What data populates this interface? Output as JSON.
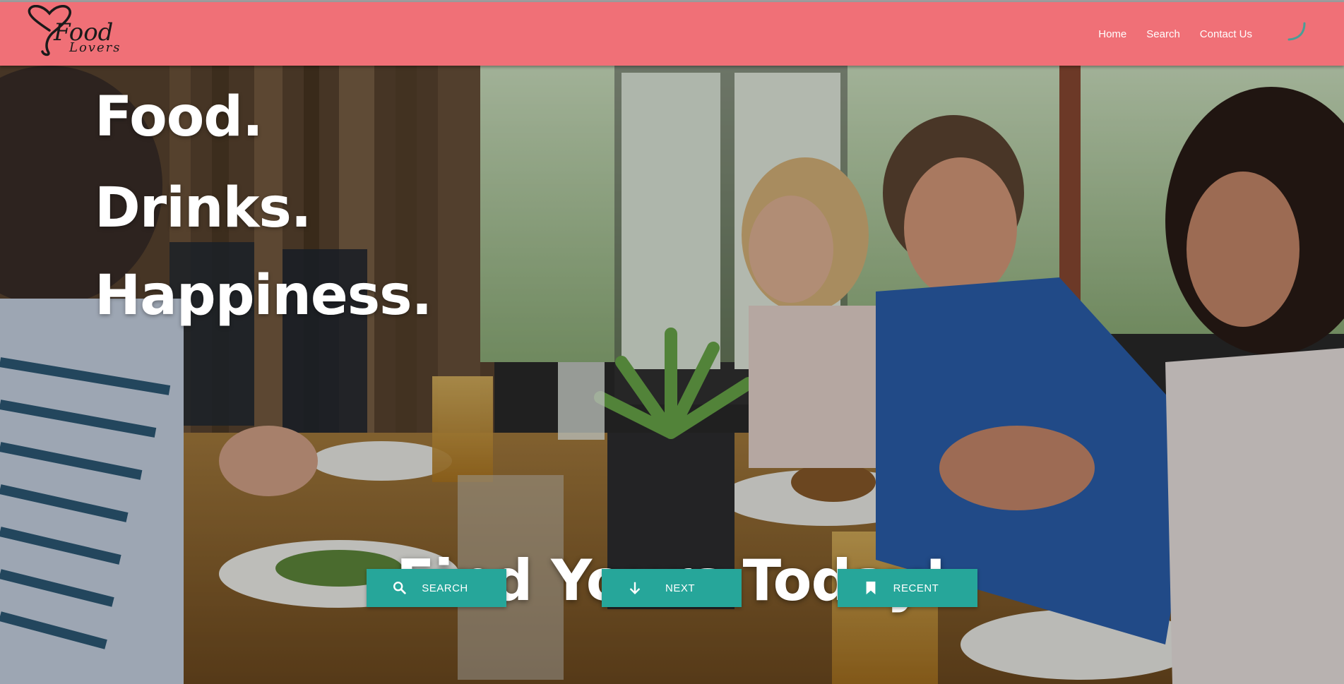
{
  "brand": {
    "logo_line1": "Food",
    "logo_line2": "Lovers",
    "navbar_color": "#f07077"
  },
  "nav": {
    "items": [
      {
        "label": "Home"
      },
      {
        "label": "Search"
      },
      {
        "label": "Contact Us"
      }
    ]
  },
  "hero": {
    "headline": [
      "Food.",
      "Drinks.",
      "Happiness."
    ],
    "tagline": "Find Yours Today!",
    "background": "photo of friends eating and drinking at a restaurant table"
  },
  "actions": {
    "accent_color": "#26a69a",
    "buttons": [
      {
        "label": "SEARCH",
        "icon": "search-icon"
      },
      {
        "label": "NEXT",
        "icon": "arrow-down-icon"
      },
      {
        "label": "RECENT",
        "icon": "bookmark-icon"
      }
    ]
  }
}
